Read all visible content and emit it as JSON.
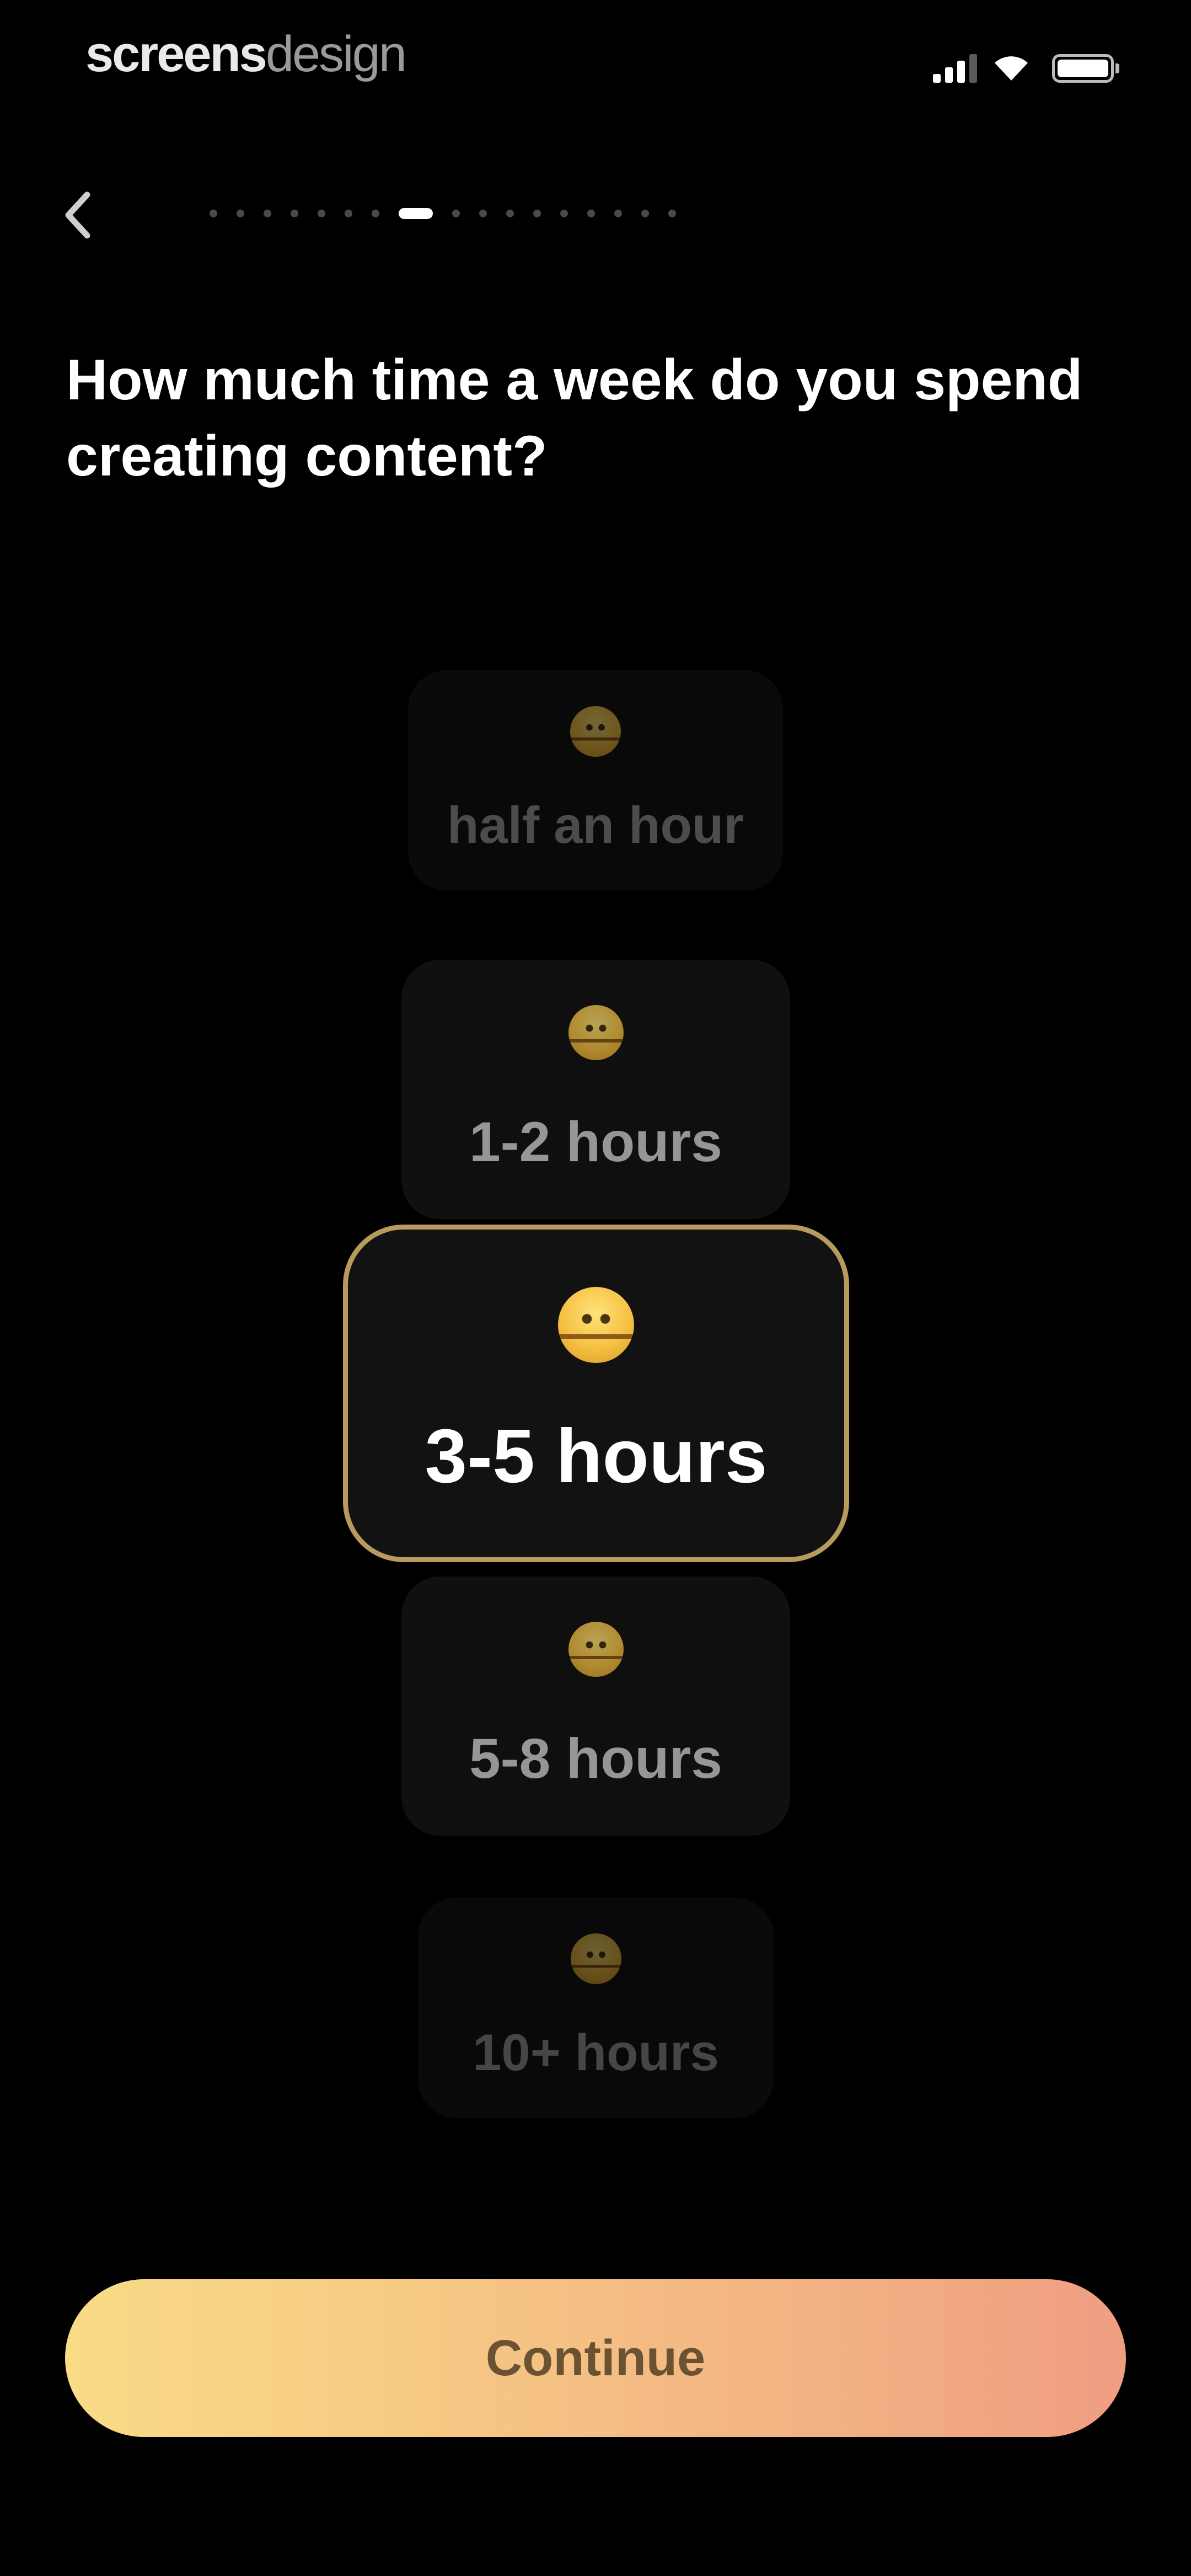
{
  "status_bar": {
    "watermark_bold": "screens",
    "watermark_light": "design"
  },
  "nav": {
    "back_icon": "chevron-left-icon",
    "progress": {
      "total_steps": 17,
      "current_step": 8
    }
  },
  "question": "How much time a week do you spend creating content?",
  "options": [
    {
      "label": "half an hour",
      "icon": "emoji-face-icon",
      "selected": false
    },
    {
      "label": "1-2 hours",
      "icon": "emoji-face-icon",
      "selected": false
    },
    {
      "label": "3-5 hours",
      "icon": "emoji-face-icon",
      "selected": true
    },
    {
      "label": "5-8 hours",
      "icon": "emoji-face-icon",
      "selected": false
    },
    {
      "label": "10+ hours",
      "icon": "emoji-face-icon",
      "selected": false
    }
  ],
  "continue_label": "Continue",
  "colors": {
    "background": "#000000",
    "selected_border": "#b79a5e",
    "button_gradient_start": "#f9dc86",
    "button_gradient_end": "#f09e82"
  }
}
